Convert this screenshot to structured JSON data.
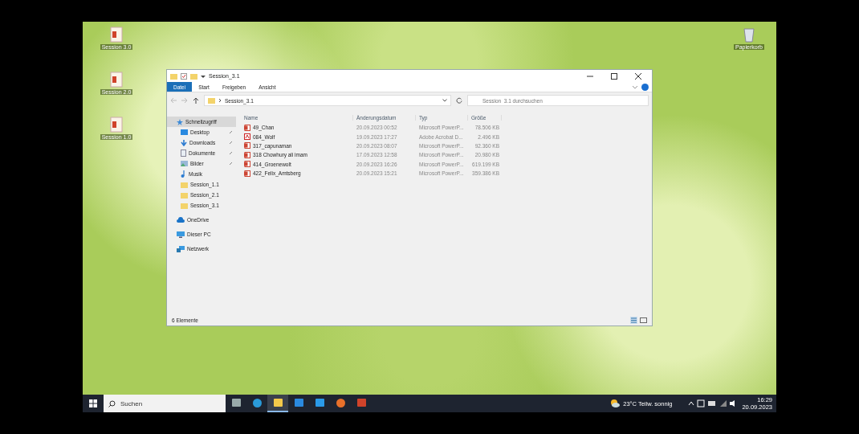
{
  "desktop_icons": [
    {
      "label": "Session 3.0"
    },
    {
      "label": "Session 2.0"
    },
    {
      "label": "Session 1.0"
    }
  ],
  "recycle_bin": {
    "label": "Papierkorb"
  },
  "window": {
    "title": "Session_3.1",
    "ribbon_tabs": [
      {
        "label": "Datei",
        "selected": true
      },
      {
        "label": "Start",
        "selected": false
      },
      {
        "label": "Freigeben",
        "selected": false
      },
      {
        "label": "Ansicht",
        "selected": false
      }
    ],
    "address": {
      "path": "Session_3.1"
    },
    "search": {
      "placeholder": "Session_3.1 durchsuchen"
    },
    "sidebar": [
      {
        "label": "Schnellzugriff",
        "kind": "star",
        "selected": true,
        "children": [
          {
            "label": "Desktop",
            "kind": "desktop",
            "pinned": true
          },
          {
            "label": "Downloads",
            "kind": "download",
            "pinned": true
          },
          {
            "label": "Dokumente",
            "kind": "document",
            "pinned": true
          },
          {
            "label": "Bilder",
            "kind": "picture",
            "pinned": true
          },
          {
            "label": "Musik",
            "kind": "music",
            "pinned": false
          },
          {
            "label": "Session_1.1",
            "kind": "folder",
            "pinned": false
          },
          {
            "label": "Session_2.1",
            "kind": "folder",
            "pinned": false
          },
          {
            "label": "Session_3.1",
            "kind": "folder",
            "pinned": false
          }
        ]
      },
      {
        "label": "OneDrive",
        "kind": "cloud",
        "selected": false
      },
      {
        "label": "Dieser PC",
        "kind": "pc",
        "selected": false
      },
      {
        "label": "Netzwerk",
        "kind": "network",
        "selected": false
      }
    ],
    "columns": [
      "Name",
      "Änderungsdatum",
      "Typ",
      "Größe"
    ],
    "rows": [
      {
        "name": "49_Chan",
        "date": "20.09.2023 00:52",
        "type": "Microsoft PowerP...",
        "size": "78.506 KB",
        "kind": "pptx"
      },
      {
        "name": "084_Wolf",
        "date": "19.09.2023 17:27",
        "type": "Adobe Acrobat D...",
        "size": "2.496 KB",
        "kind": "pdf"
      },
      {
        "name": "317_capunaman",
        "date": "20.09.2023 08:07",
        "type": "Microsoft PowerP...",
        "size": "92.360 KB",
        "kind": "pptx"
      },
      {
        "name": "318 Chowhury ali imam",
        "date": "17.09.2023 12:58",
        "type": "Microsoft PowerP...",
        "size": "20.980 KB",
        "kind": "pptx"
      },
      {
        "name": "414_Groenewolt",
        "date": "20.09.2023 16:26",
        "type": "Microsoft PowerP...",
        "size": "619.199 KB",
        "kind": "pptx"
      },
      {
        "name": "422_Felix_Amtsberg",
        "date": "20.09.2023 15:21",
        "type": "Microsoft PowerP...",
        "size": "359.386 KB",
        "kind": "pptx"
      }
    ],
    "status": "6 Elemente"
  },
  "taskbar": {
    "search_placeholder": "Suchen",
    "apps": [
      {
        "kind": "taskview",
        "active": false
      },
      {
        "kind": "edge",
        "active": false
      },
      {
        "kind": "explorer",
        "active": true
      },
      {
        "kind": "store",
        "active": false
      },
      {
        "kind": "mail",
        "active": false
      },
      {
        "kind": "firefox",
        "active": false
      },
      {
        "kind": "powerpoint",
        "active": false
      }
    ],
    "weather": "23°C  Teilw. sonnig",
    "time": "16:29",
    "date": "20.09.2023"
  }
}
